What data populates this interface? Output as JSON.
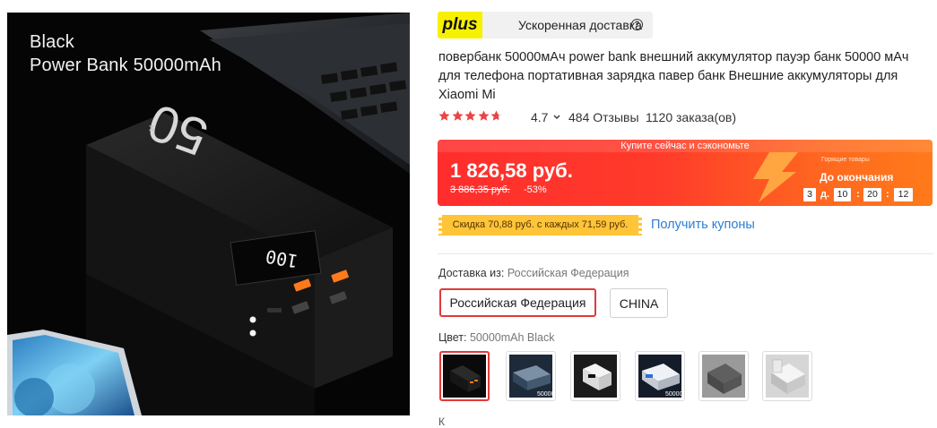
{
  "photo": {
    "line1": "Black",
    "line2": "Power Bank 50000mAh",
    "lcd_text": "100",
    "device_print": "50"
  },
  "plus_bar": {
    "logo": "plus",
    "text": "Ускоренная доставка",
    "help_icon": "?"
  },
  "product": {
    "title": "повербанк 50000мАч power bank внешний аккумулятор пауэр банк 50000 мАч для телефона портативная зарядка павер банк Внешние аккумуляторы для Xiaomi Mi"
  },
  "rating": {
    "stars": 4.7,
    "value": "4.7",
    "reviews": "484 Отзывы",
    "orders": "1120 заказа(ов)",
    "star_color": "#ea4545"
  },
  "price_banner": {
    "top_label": "Купите сейчас и сэкономьте",
    "price": "1 826,58 руб.",
    "old_price": "3 886,35 руб.",
    "discount": "-53%",
    "hot_label": "Горящие товары",
    "ends_label": "До окончания",
    "timer": {
      "days": "3",
      "days_unit": "д.",
      "hours": "10",
      "minutes": "20",
      "seconds": "12"
    }
  },
  "coupon": {
    "tag": "Скидка 70,88 руб. с каждых 71,59 руб.",
    "link": "Получить купоны"
  },
  "shipping": {
    "label": "Доставка из:",
    "selected": "Российская Федерация",
    "options": [
      "Российская Федерация",
      "CHINA"
    ]
  },
  "color": {
    "label": "Цвет:",
    "selected": "50000mAh Black",
    "swatches": [
      "50000mAh Black",
      "50000",
      "50000 white",
      "50000",
      "grey",
      "white"
    ],
    "swatch_prints": [
      "",
      "50000",
      "",
      "50000",
      "",
      ""
    ]
  },
  "footer": {
    "cut_letter": "К"
  },
  "colors": {
    "accent_red": "#e03a3a",
    "link_blue": "#2a7fd4",
    "plus_yellow": "#f7f100",
    "coupon_yellow": "#ffc438"
  }
}
